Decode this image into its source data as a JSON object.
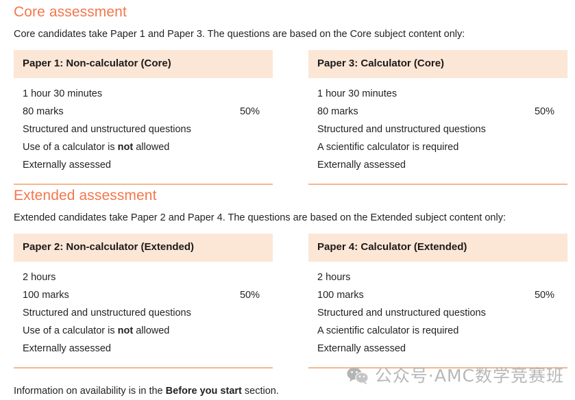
{
  "core": {
    "heading": "Core assessment",
    "intro": "Core candidates take Paper 1 and Paper 3. The questions are based on the Core subject content only:",
    "papers": [
      {
        "title": "Paper 1: Non-calculator (Core)",
        "duration": "1 hour 30 minutes",
        "marks": "80 marks",
        "weight": "50%",
        "question_types": "Structured and unstructured questions",
        "calculator_prefix": "Use of a calculator is ",
        "calculator_emphasis": "not",
        "calculator_suffix": " allowed",
        "assessment": "Externally assessed"
      },
      {
        "title": "Paper 3: Calculator (Core)",
        "duration": "1 hour 30 minutes",
        "marks": "80 marks",
        "weight": "50%",
        "question_types": "Structured and unstructured questions",
        "calculator_prefix": "A scientific calculator is required",
        "calculator_emphasis": "",
        "calculator_suffix": "",
        "assessment": "Externally assessed"
      }
    ]
  },
  "extended": {
    "heading": "Extended assessment",
    "intro": "Extended candidates take Paper 2 and Paper 4. The questions are based on the Extended subject content only:",
    "papers": [
      {
        "title": "Paper 2: Non-calculator (Extended)",
        "duration": "2 hours",
        "marks": "100 marks",
        "weight": "50%",
        "question_types": "Structured and unstructured questions",
        "calculator_prefix": "Use of a calculator is ",
        "calculator_emphasis": "not",
        "calculator_suffix": " allowed",
        "assessment": "Externally assessed"
      },
      {
        "title": "Paper 4: Calculator (Extended)",
        "duration": "2 hours",
        "marks": "100 marks",
        "weight": "50%",
        "question_types": "Structured and unstructured questions",
        "calculator_prefix": "A scientific calculator is required",
        "calculator_emphasis": "",
        "calculator_suffix": "",
        "assessment": "Externally assessed"
      }
    ]
  },
  "footer": {
    "note_prefix": "Information on availability is in the ",
    "note_emphasis": "Before you start",
    "note_suffix": " section."
  },
  "watermark": {
    "icon": "wechat-icon",
    "text": "公众号·AMC数学竞赛班"
  },
  "colors": {
    "heading_orange": "#f4764b",
    "card_header_bg": "#fce6d6",
    "card_border": "#f6b78e",
    "body_text": "#231f20",
    "watermark_gray": "#b8b8b8"
  }
}
